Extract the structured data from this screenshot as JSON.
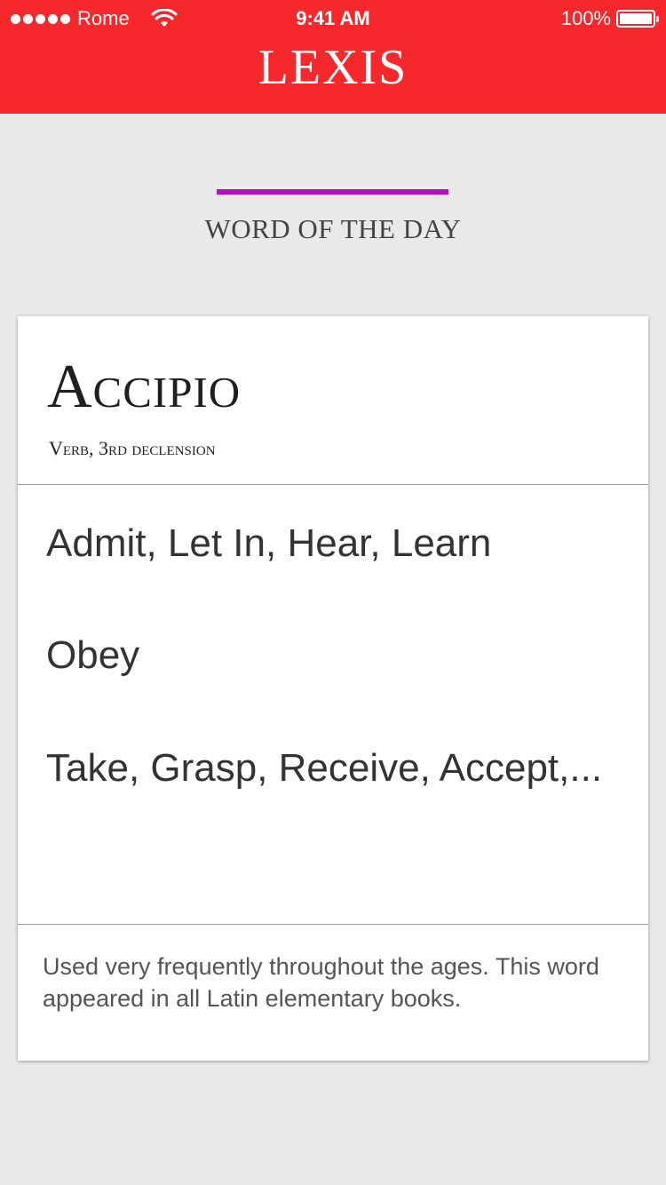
{
  "status_bar": {
    "carrier": "Rome",
    "time": "9:41 AM",
    "battery": "100%",
    "battery_level": 1.0
  },
  "header": {
    "title": "LEXIS",
    "background_color": "#f6282b"
  },
  "section": {
    "title": "WORD OF THE DAY",
    "accent_color": "#b20fbc"
  },
  "card": {
    "word": "Accipio",
    "word_type": "Verb, 3rd declension",
    "meanings": [
      "Admit, Let In, Hear, Learn",
      "Obey",
      "Take, Grasp, Receive, Accept,..."
    ],
    "note": "Used very frequently throughout the ages. This word appeared in all Latin elementary books."
  },
  "icons": {
    "signal": "signal-dots-icon",
    "wifi": "wifi-icon",
    "battery": "battery-icon"
  }
}
